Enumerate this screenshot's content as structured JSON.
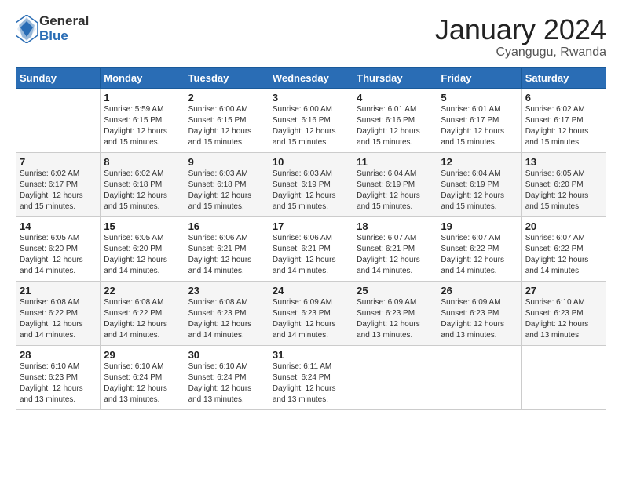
{
  "logo": {
    "general": "General",
    "blue": "Blue"
  },
  "title": "January 2024",
  "subtitle": "Cyangugu, Rwanda",
  "days_header": [
    "Sunday",
    "Monday",
    "Tuesday",
    "Wednesday",
    "Thursday",
    "Friday",
    "Saturday"
  ],
  "weeks": [
    [
      {
        "day": "",
        "info": ""
      },
      {
        "day": "1",
        "info": "Sunrise: 5:59 AM\nSunset: 6:15 PM\nDaylight: 12 hours\nand 15 minutes."
      },
      {
        "day": "2",
        "info": "Sunrise: 6:00 AM\nSunset: 6:15 PM\nDaylight: 12 hours\nand 15 minutes."
      },
      {
        "day": "3",
        "info": "Sunrise: 6:00 AM\nSunset: 6:16 PM\nDaylight: 12 hours\nand 15 minutes."
      },
      {
        "day": "4",
        "info": "Sunrise: 6:01 AM\nSunset: 6:16 PM\nDaylight: 12 hours\nand 15 minutes."
      },
      {
        "day": "5",
        "info": "Sunrise: 6:01 AM\nSunset: 6:17 PM\nDaylight: 12 hours\nand 15 minutes."
      },
      {
        "day": "6",
        "info": "Sunrise: 6:02 AM\nSunset: 6:17 PM\nDaylight: 12 hours\nand 15 minutes."
      }
    ],
    [
      {
        "day": "7",
        "info": "Sunrise: 6:02 AM\nSunset: 6:17 PM\nDaylight: 12 hours\nand 15 minutes."
      },
      {
        "day": "8",
        "info": "Sunrise: 6:02 AM\nSunset: 6:18 PM\nDaylight: 12 hours\nand 15 minutes."
      },
      {
        "day": "9",
        "info": "Sunrise: 6:03 AM\nSunset: 6:18 PM\nDaylight: 12 hours\nand 15 minutes."
      },
      {
        "day": "10",
        "info": "Sunrise: 6:03 AM\nSunset: 6:19 PM\nDaylight: 12 hours\nand 15 minutes."
      },
      {
        "day": "11",
        "info": "Sunrise: 6:04 AM\nSunset: 6:19 PM\nDaylight: 12 hours\nand 15 minutes."
      },
      {
        "day": "12",
        "info": "Sunrise: 6:04 AM\nSunset: 6:19 PM\nDaylight: 12 hours\nand 15 minutes."
      },
      {
        "day": "13",
        "info": "Sunrise: 6:05 AM\nSunset: 6:20 PM\nDaylight: 12 hours\nand 15 minutes."
      }
    ],
    [
      {
        "day": "14",
        "info": "Sunrise: 6:05 AM\nSunset: 6:20 PM\nDaylight: 12 hours\nand 14 minutes."
      },
      {
        "day": "15",
        "info": "Sunrise: 6:05 AM\nSunset: 6:20 PM\nDaylight: 12 hours\nand 14 minutes."
      },
      {
        "day": "16",
        "info": "Sunrise: 6:06 AM\nSunset: 6:21 PM\nDaylight: 12 hours\nand 14 minutes."
      },
      {
        "day": "17",
        "info": "Sunrise: 6:06 AM\nSunset: 6:21 PM\nDaylight: 12 hours\nand 14 minutes."
      },
      {
        "day": "18",
        "info": "Sunrise: 6:07 AM\nSunset: 6:21 PM\nDaylight: 12 hours\nand 14 minutes."
      },
      {
        "day": "19",
        "info": "Sunrise: 6:07 AM\nSunset: 6:22 PM\nDaylight: 12 hours\nand 14 minutes."
      },
      {
        "day": "20",
        "info": "Sunrise: 6:07 AM\nSunset: 6:22 PM\nDaylight: 12 hours\nand 14 minutes."
      }
    ],
    [
      {
        "day": "21",
        "info": "Sunrise: 6:08 AM\nSunset: 6:22 PM\nDaylight: 12 hours\nand 14 minutes."
      },
      {
        "day": "22",
        "info": "Sunrise: 6:08 AM\nSunset: 6:22 PM\nDaylight: 12 hours\nand 14 minutes."
      },
      {
        "day": "23",
        "info": "Sunrise: 6:08 AM\nSunset: 6:23 PM\nDaylight: 12 hours\nand 14 minutes."
      },
      {
        "day": "24",
        "info": "Sunrise: 6:09 AM\nSunset: 6:23 PM\nDaylight: 12 hours\nand 14 minutes."
      },
      {
        "day": "25",
        "info": "Sunrise: 6:09 AM\nSunset: 6:23 PM\nDaylight: 12 hours\nand 13 minutes."
      },
      {
        "day": "26",
        "info": "Sunrise: 6:09 AM\nSunset: 6:23 PM\nDaylight: 12 hours\nand 13 minutes."
      },
      {
        "day": "27",
        "info": "Sunrise: 6:10 AM\nSunset: 6:23 PM\nDaylight: 12 hours\nand 13 minutes."
      }
    ],
    [
      {
        "day": "28",
        "info": "Sunrise: 6:10 AM\nSunset: 6:23 PM\nDaylight: 12 hours\nand 13 minutes."
      },
      {
        "day": "29",
        "info": "Sunrise: 6:10 AM\nSunset: 6:24 PM\nDaylight: 12 hours\nand 13 minutes."
      },
      {
        "day": "30",
        "info": "Sunrise: 6:10 AM\nSunset: 6:24 PM\nDaylight: 12 hours\nand 13 minutes."
      },
      {
        "day": "31",
        "info": "Sunrise: 6:11 AM\nSunset: 6:24 PM\nDaylight: 12 hours\nand 13 minutes."
      },
      {
        "day": "",
        "info": ""
      },
      {
        "day": "",
        "info": ""
      },
      {
        "day": "",
        "info": ""
      }
    ]
  ]
}
